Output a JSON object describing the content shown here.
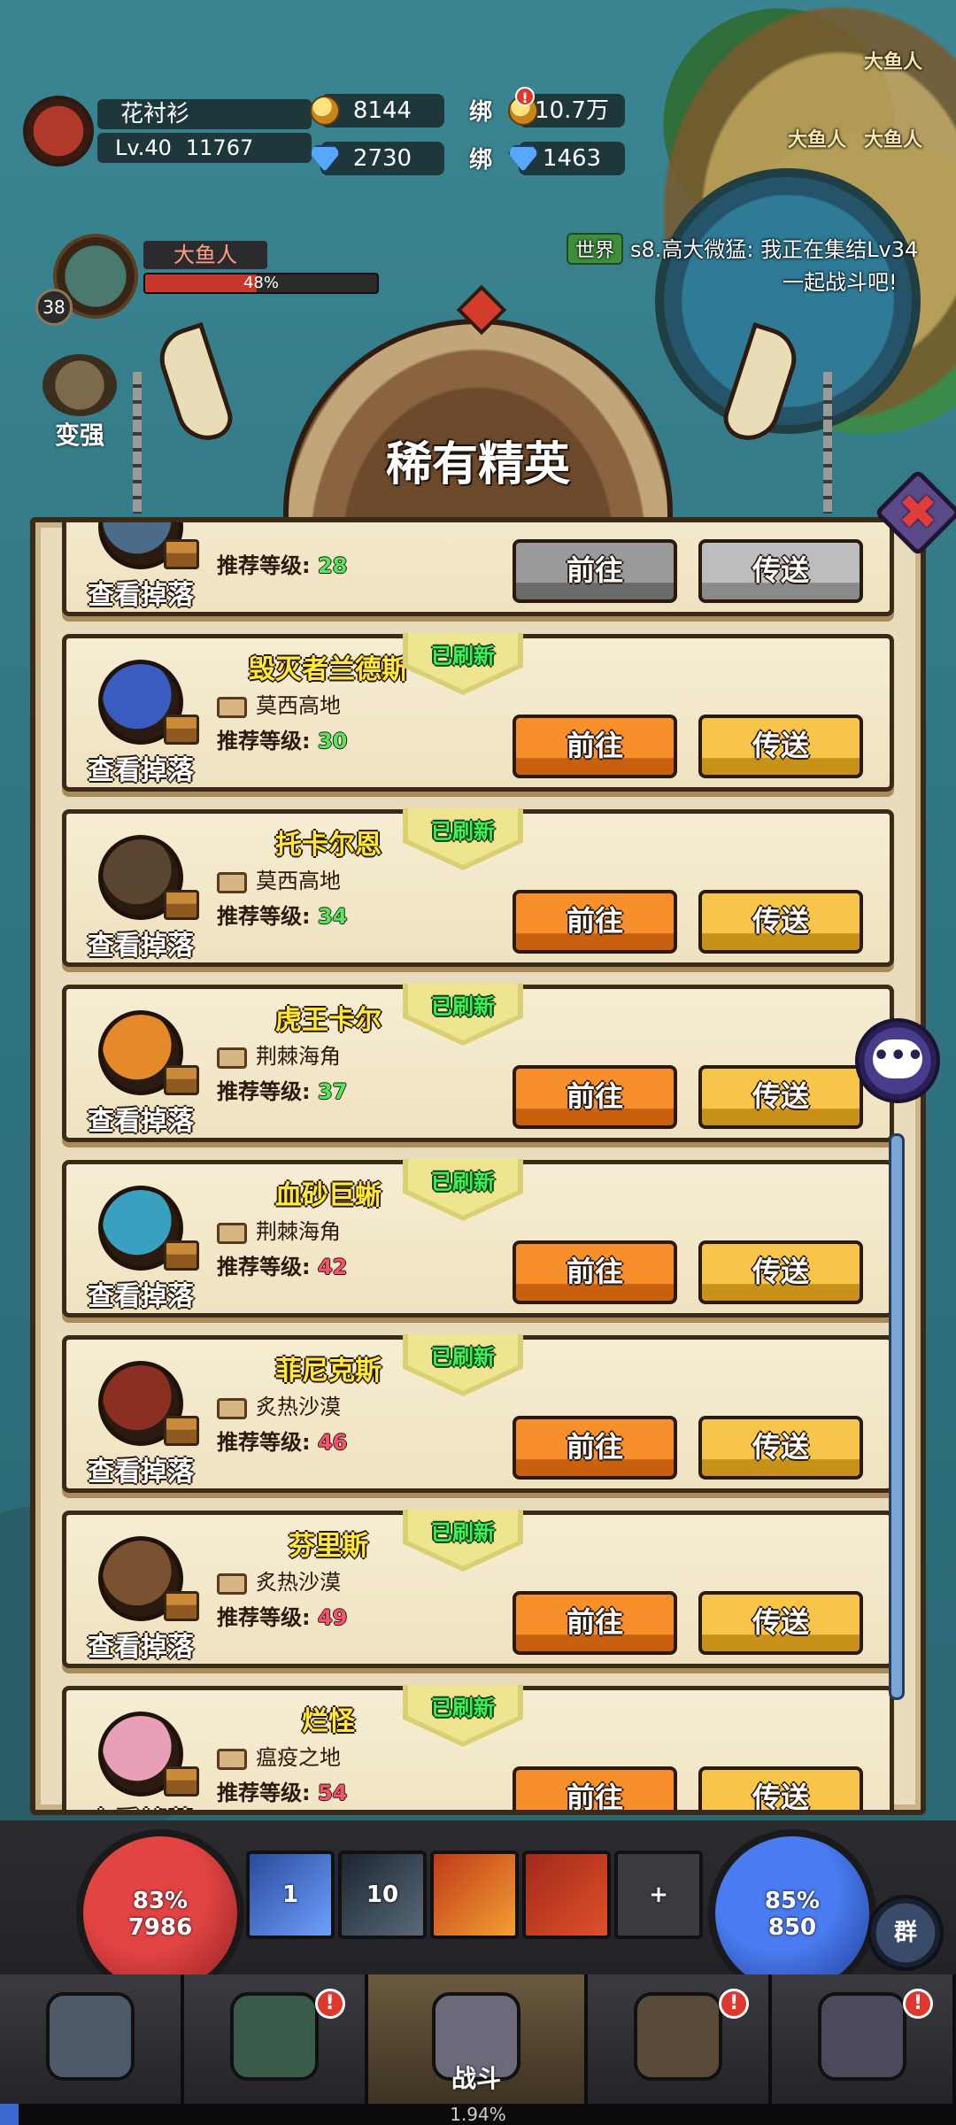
{
  "hud": {
    "player": {
      "name": "花衬衫",
      "level": "Lv.40",
      "power": "11767"
    },
    "gold": "8144",
    "bind_label": "绑",
    "bind_gold": "10.7万",
    "diamonds": "2730",
    "bind_diamonds": "1463",
    "alert": "!",
    "world_chat": {
      "channel": "世界",
      "line1": "s8.高大微猛: 我正在集结Lv34",
      "line2": "一起战斗吧!"
    },
    "target": {
      "name": "大鱼人",
      "level": "38",
      "hp_percent": 48,
      "hp_text": "48%"
    },
    "strengthen_label": "变强",
    "map_labels": [
      "大鱼人",
      "大鱼人",
      "大鱼人"
    ]
  },
  "modal": {
    "title": "稀有精英",
    "close_symbol": "✖",
    "refresh_label": "已刷新",
    "drop_label": "查看掉落",
    "rec_prefix": "推荐等级:",
    "go_label": "前往",
    "teleport_label": "传送",
    "bosses": [
      {
        "name": "",
        "map": "",
        "level": "28",
        "level_color": "green",
        "refreshed": false,
        "disabled": true,
        "avatar_color": "#4b6b8a"
      },
      {
        "name": "毁灭者兰德斯",
        "map": "莫西高地",
        "level": "30",
        "level_color": "green",
        "refreshed": true,
        "disabled": false,
        "avatar_color": "#3a5bbf"
      },
      {
        "name": "托卡尔恩",
        "map": "莫西高地",
        "level": "34",
        "level_color": "green",
        "refreshed": true,
        "disabled": false,
        "avatar_color": "#5a4630"
      },
      {
        "name": "虎王卡尔",
        "map": "荆棘海角",
        "level": "37",
        "level_color": "green",
        "refreshed": true,
        "disabled": false,
        "avatar_color": "#e58a2a"
      },
      {
        "name": "血砂巨蜥",
        "map": "荆棘海角",
        "level": "42",
        "level_color": "red",
        "refreshed": true,
        "disabled": false,
        "avatar_color": "#3aa0c0"
      },
      {
        "name": "菲尼克斯",
        "map": "炙热沙漠",
        "level": "46",
        "level_color": "red",
        "refreshed": true,
        "disabled": false,
        "avatar_color": "#8a2f22"
      },
      {
        "name": "芬里斯",
        "map": "炙热沙漠",
        "level": "49",
        "level_color": "red",
        "refreshed": true,
        "disabled": false,
        "avatar_color": "#7a5232"
      },
      {
        "name": "烂怪",
        "map": "瘟疫之地",
        "level": "54",
        "level_color": "red",
        "refreshed": true,
        "disabled": false,
        "avatar_color": "#e7a0b8"
      }
    ]
  },
  "bottom": {
    "hp": {
      "percent": "83%",
      "value": "7986"
    },
    "mp": {
      "percent": "85%",
      "value": "850"
    },
    "skills": [
      "1",
      "10",
      "",
      "",
      "+"
    ],
    "group_label": "群",
    "nav": [
      {
        "label": "",
        "badge": ""
      },
      {
        "label": "",
        "badge": "!"
      },
      {
        "label": "战斗",
        "badge": ""
      },
      {
        "label": "",
        "badge": "!"
      },
      {
        "label": "",
        "badge": "!"
      }
    ],
    "exp_percent": 1.94,
    "exp_text": "1.94%"
  },
  "colors": {
    "level_green": "#59e65a",
    "level_red": "#ff4f6a",
    "go_button": "#f7902a",
    "teleport_button": "#f7c54a"
  }
}
